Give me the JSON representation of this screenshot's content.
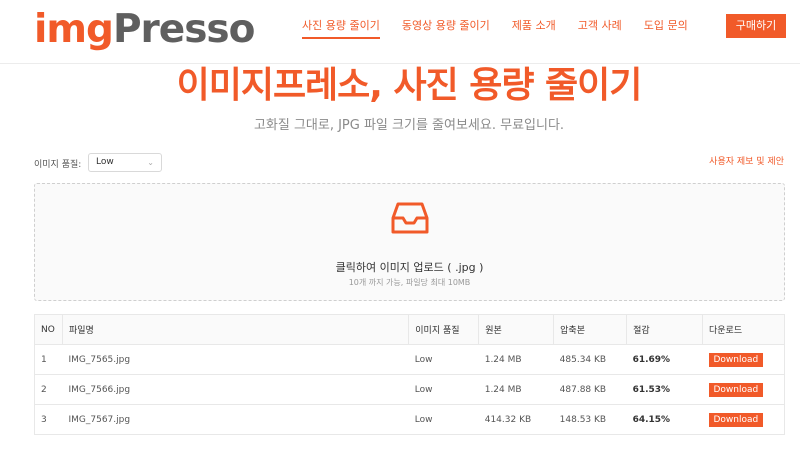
{
  "brand": {
    "logo_part1": "img",
    "logo_part2": "Presso"
  },
  "nav": [
    {
      "label": "사진 용량 줄이기",
      "active": true
    },
    {
      "label": "동영상 용량 줄이기"
    },
    {
      "label": "제품 소개"
    },
    {
      "label": "고객 사례"
    },
    {
      "label": "도입 문의"
    }
  ],
  "buy_button": "구매하기",
  "hero": {
    "title": "이미지프레소, 사진 용량 줄이기",
    "subtitle": "고화질 그대로, JPG 파일 크기를 줄여보세요. 무료입니다."
  },
  "quality": {
    "label": "이미지 품질:",
    "value": "Low"
  },
  "report_link": "사용자 제보 및 제안",
  "upload": {
    "title": "클릭하여 이미지 업로드 ( .jpg )",
    "hint": "10개 까지 가능, 파일당 최대 10MB"
  },
  "table": {
    "columns": [
      "NO",
      "파일명",
      "이미지 품질",
      "원본",
      "압축본",
      "절감",
      "다운로드"
    ],
    "rows": [
      {
        "no": "1",
        "filename": "IMG_7565.jpg",
        "quality": "Low",
        "original": "1.24 MB",
        "compressed": "485.34 KB",
        "saving": "61.69%",
        "download": "Download"
      },
      {
        "no": "2",
        "filename": "IMG_7566.jpg",
        "quality": "Low",
        "original": "1.24 MB",
        "compressed": "487.88 KB",
        "saving": "61.53%",
        "download": "Download"
      },
      {
        "no": "3",
        "filename": "IMG_7567.jpg",
        "quality": "Low",
        "original": "414.32 KB",
        "compressed": "148.53 KB",
        "saving": "64.15%",
        "download": "Download"
      }
    ]
  },
  "colors": {
    "accent": "#f15a29",
    "logo_gray": "#5f5f5f"
  }
}
